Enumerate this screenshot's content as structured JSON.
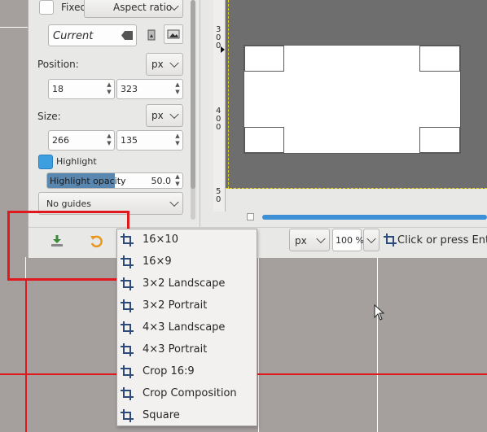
{
  "tool_options": {
    "fixed_label": "Fixed",
    "fixed_mode": "Aspect ratio",
    "current_value": "Current",
    "position_label": "Position:",
    "position_unit": "px",
    "position_x": "18",
    "position_y": "323",
    "size_label": "Size:",
    "size_unit": "px",
    "size_w": "266",
    "size_h": "135",
    "highlight_label": "Highlight",
    "highlight_opacity_label": "Highlight opacity",
    "highlight_opacity_value": "50.0",
    "guides_value": "No guides"
  },
  "canvas": {
    "ruler_marks": [
      "3",
      "0",
      "0",
      "4",
      "0",
      "0",
      "5",
      "0"
    ]
  },
  "statusbar": {
    "unit": "px",
    "zoom": "100 %",
    "message": "Click or press Ente"
  },
  "presets_menu": {
    "items": [
      "16×10",
      "16×9",
      "3×2 Landscape",
      "3×2 Portrait",
      "4×3 Landscape",
      "4×3 Portrait",
      "Crop 16:9",
      "Crop Composition",
      "Square"
    ]
  },
  "colors": {
    "highlight_checkbox": "#3d9ee0",
    "annotation_red": "#e0191e",
    "scrollbar_blue": "#3d8fd6"
  }
}
